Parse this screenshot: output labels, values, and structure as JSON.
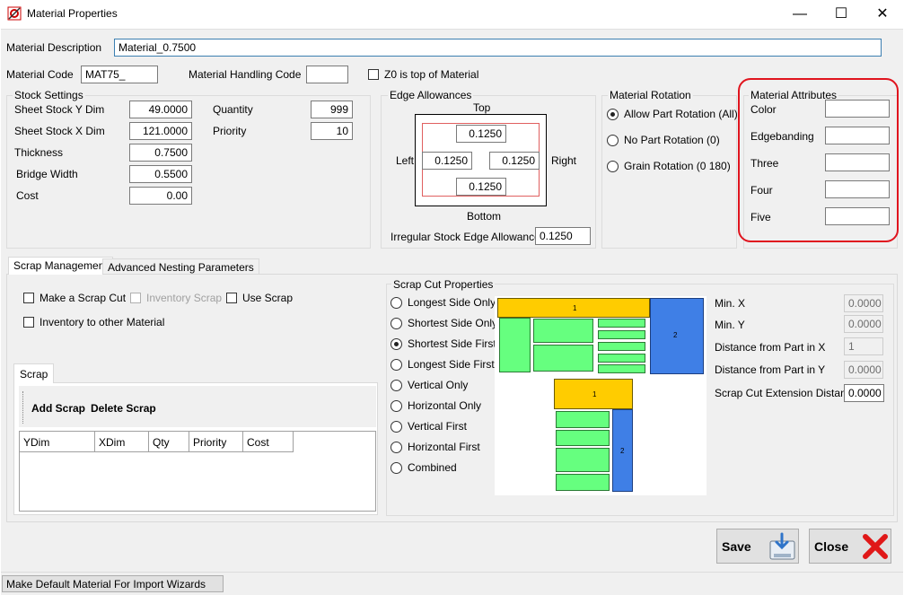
{
  "window": {
    "title": "Material Properties",
    "minimize": "—",
    "maximize": "☐",
    "close": "✕"
  },
  "material": {
    "description_label": "Material Description",
    "description_value": "Material_0.7500",
    "code_label": "Material Code",
    "code_value": "MAT75_",
    "handling_label": "Material Handling Code",
    "handling_value": "",
    "z0_label": "Z0 is top of Material"
  },
  "stock": {
    "title": "Stock Settings",
    "y_dim_label": "Sheet Stock Y Dim",
    "y_dim": "49.0000",
    "x_dim_label": "Sheet Stock X Dim",
    "x_dim": "121.0000",
    "thickness_label": "Thickness",
    "thickness": "0.7500",
    "bridge_label": "Bridge Width",
    "bridge": "0.5500",
    "cost_label": "Cost",
    "cost": "0.00",
    "quantity_label": "Quantity",
    "quantity": "999",
    "priority_label": "Priority",
    "priority": "10"
  },
  "edge": {
    "title": "Edge Allowances",
    "top_label": "Top",
    "bottom_label": "Bottom",
    "left_label": "Left",
    "right_label": "Right",
    "top": "0.1250",
    "bottom": "0.1250",
    "left": "0.1250",
    "right": "0.1250",
    "irregular_label": "Irregular Stock Edge Allowance",
    "irregular": "0.1250"
  },
  "rotation": {
    "title": "Material Rotation",
    "options": [
      "Allow Part Rotation (All)",
      "No Part Rotation (0)",
      "Grain Rotation (0 180)"
    ],
    "selected": 0
  },
  "attributes": {
    "title": "Material Attributes",
    "items": [
      {
        "label": "Color",
        "value": ""
      },
      {
        "label": "Edgebanding",
        "value": ""
      },
      {
        "label": "Three",
        "value": ""
      },
      {
        "label": "Four",
        "value": ""
      },
      {
        "label": "Five",
        "value": ""
      }
    ],
    "highlight_color": "#e0141e"
  },
  "tabs": {
    "scrap_management": "Scrap Management",
    "advanced_nesting": "Advanced Nesting Parameters"
  },
  "scrap_mgmt": {
    "make_scrap_cut": "Make a Scrap Cut",
    "inventory_scrap": "Inventory Scrap",
    "use_scrap": "Use Scrap",
    "inventory_other": "Inventory to other Material",
    "scrap_tab": "Scrap",
    "add_scrap": "Add Scrap",
    "delete_scrap": "Delete Scrap",
    "columns": [
      "YDim",
      "XDim",
      "Qty",
      "Priority",
      "Cost"
    ]
  },
  "scrap_cut": {
    "title": "Scrap Cut Properties",
    "options": [
      "Longest Side Only",
      "Shortest Side Only",
      "Shortest Side First",
      "Longest Side First",
      "Vertical Only",
      "Horizontal Only",
      "Vertical First",
      "Horizontal First",
      "Combined"
    ],
    "selected": 2,
    "diagram_label_1": "1",
    "diagram_label_2": "2",
    "min_x_label": "Min. X",
    "min_x": "0.0000",
    "min_y_label": "Min. Y",
    "min_y": "0.0000",
    "dist_x_label": "Distance from Part in X",
    "dist_x": "1",
    "dist_y_label": "Distance from Part in Y",
    "dist_y": "0.0000",
    "ext_label": "Scrap Cut Extension Distance",
    "ext": "0.0000"
  },
  "buttons": {
    "save": "Save",
    "close": "Close"
  },
  "status": {
    "default_material": "Make Default Material For Import Wizards"
  }
}
